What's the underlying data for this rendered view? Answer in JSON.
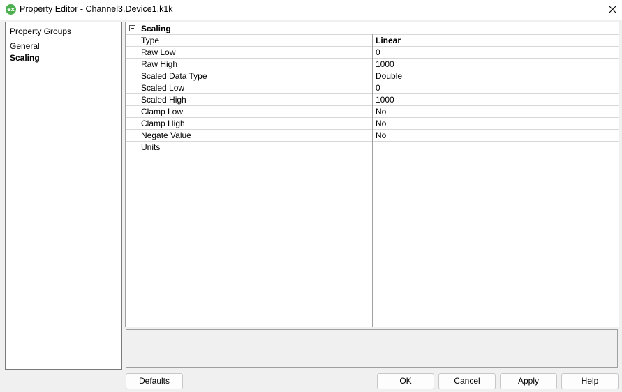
{
  "window": {
    "title": "Property Editor - Channel3.Device1.k1k",
    "app_icon_text": "ex"
  },
  "sidebar": {
    "header": "Property Groups",
    "items": [
      {
        "label": "General",
        "selected": false
      },
      {
        "label": "Scaling",
        "selected": true
      }
    ]
  },
  "grid": {
    "group_title": "Scaling",
    "properties": [
      {
        "name": "Type",
        "value": "Linear"
      },
      {
        "name": "Raw Low",
        "value": "0"
      },
      {
        "name": "Raw High",
        "value": "1000"
      },
      {
        "name": "Scaled Data Type",
        "value": "Double"
      },
      {
        "name": "Scaled Low",
        "value": "0"
      },
      {
        "name": "Scaled High",
        "value": "1000"
      },
      {
        "name": "Clamp Low",
        "value": "No"
      },
      {
        "name": "Clamp High",
        "value": "No"
      },
      {
        "name": "Negate Value",
        "value": "No"
      },
      {
        "name": "Units",
        "value": ""
      }
    ]
  },
  "buttons": {
    "defaults": "Defaults",
    "ok": "OK",
    "cancel": "Cancel",
    "apply": "Apply",
    "help": "Help"
  },
  "colors": {
    "app_icon": "#4caf50",
    "window_bg": "#f0f0f0",
    "panel_bg": "#ffffff"
  }
}
